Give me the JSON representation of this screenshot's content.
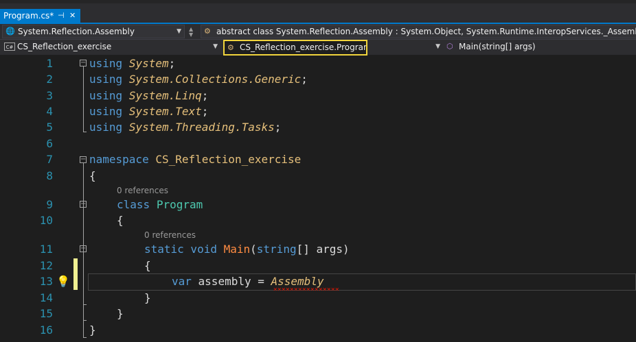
{
  "tab": {
    "title": "Program.cs*",
    "pin_glyph": "⊣",
    "close_glyph": "✕"
  },
  "nav1": {
    "assembly_dropdown": "System.Reflection.Assembly",
    "member_dropdown": "abstract class System.Reflection.Assembly : System.Object, System.Runtime.InteropServices._Assembly, Sys"
  },
  "nav2": {
    "project_dropdown": "CS_Reflection_exercise",
    "class_dropdown": "CS_Reflection_exercise.Program",
    "method_dropdown": "Main(string[] args)",
    "cs_badge": "C#"
  },
  "editor": {
    "line_numbers": [
      "1",
      "2",
      "3",
      "4",
      "5",
      "6",
      "7",
      "8",
      "9",
      "10",
      "11",
      "12",
      "13",
      "14",
      "15",
      "16"
    ],
    "codelens_class": "0 references",
    "codelens_method": "0 references",
    "tokens": {
      "using": "using",
      "system": "System",
      "collections": "System.Collections.Generic",
      "linq": "System.Linq",
      "text": "System.Text",
      "tasks": "System.Threading.Tasks",
      "semicolon": ";",
      "namespace_kw": "namespace",
      "namespace_name": "CS_Reflection_exercise",
      "open_brace": "{",
      "close_brace": "}",
      "class_kw": "class",
      "class_name": "Program",
      "static_void": "static void",
      "method_name": "Main",
      "paren_open": "(",
      "string_kw": "string",
      "array_args": "[] args)",
      "var_kw": "var",
      "assign": " assembly = ",
      "assembly_type": "Assembly"
    }
  },
  "colors": {
    "keyword": "#569cd6",
    "namespace": "#e6c07b",
    "class": "#4ec9b0",
    "line_number": "#2b91af",
    "accent": "#007acc",
    "highlight_border": "#f2d53c",
    "error_squiggle": "#e51400"
  }
}
